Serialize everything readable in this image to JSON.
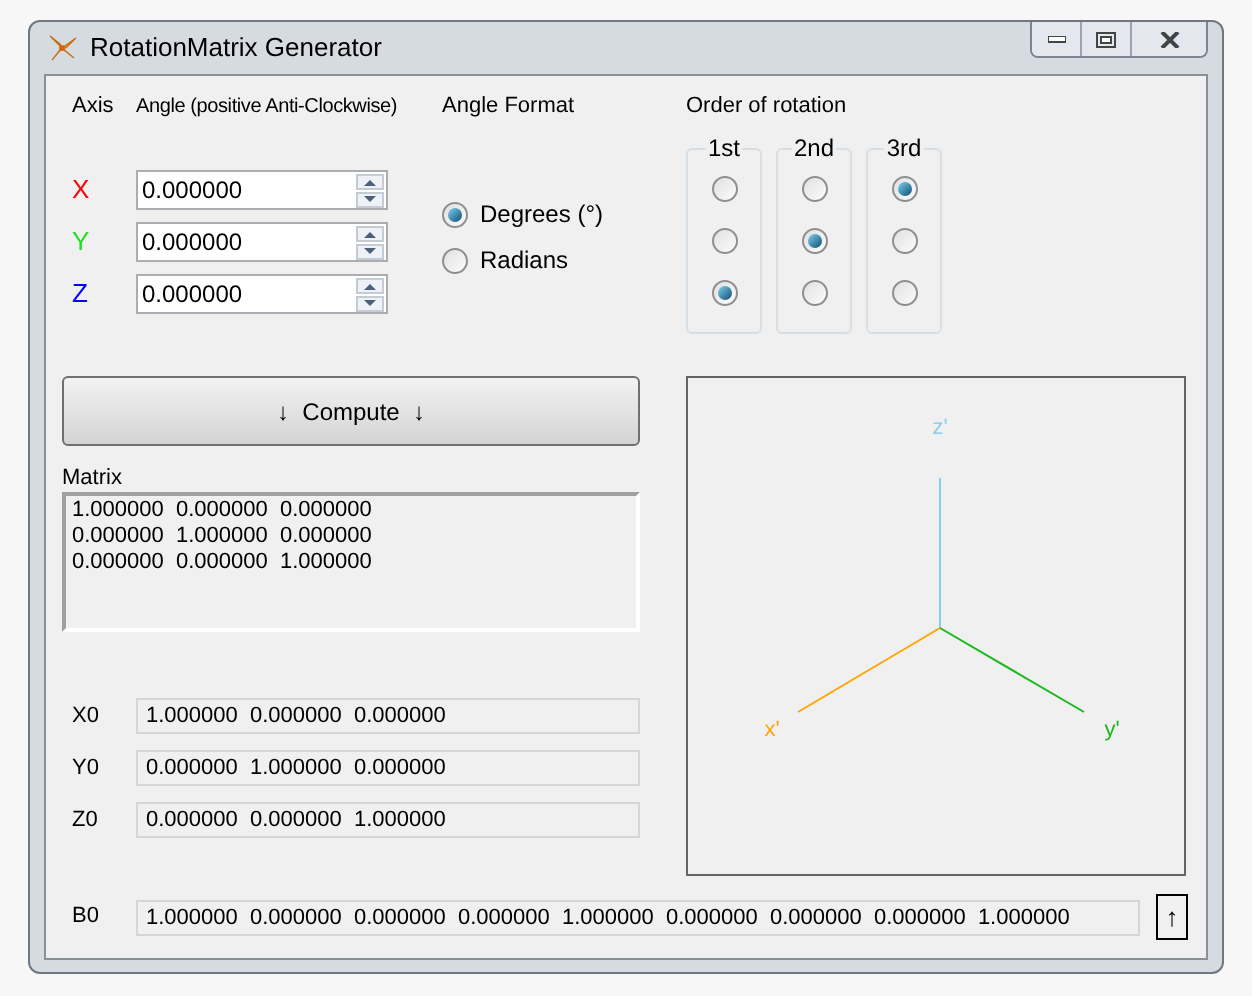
{
  "window": {
    "title": "RotationMatrix Generator"
  },
  "headers": {
    "axis": "Axis",
    "angle": "Angle (positive Anti-Clockwise)",
    "format": "Angle Format",
    "order": "Order of rotation"
  },
  "axes": [
    {
      "label": "X",
      "color": "#ff0000",
      "value": "0.000000"
    },
    {
      "label": "Y",
      "color": "#22dd22",
      "value": "0.000000"
    },
    {
      "label": "Z",
      "color": "#0000ff",
      "value": "0.000000"
    }
  ],
  "angle_format": [
    {
      "label": "Degrees (°)",
      "selected": true
    },
    {
      "label": "Radians",
      "selected": false
    }
  ],
  "order_groups": [
    {
      "label": "1st",
      "options": [
        {
          "selected": false
        },
        {
          "selected": false
        },
        {
          "selected": true
        }
      ]
    },
    {
      "label": "2nd",
      "options": [
        {
          "selected": false
        },
        {
          "selected": true
        },
        {
          "selected": false
        }
      ]
    },
    {
      "label": "3rd",
      "options": [
        {
          "selected": true
        },
        {
          "selected": false
        },
        {
          "selected": false
        }
      ]
    }
  ],
  "compute_button": {
    "label": "↓  Compute  ↓"
  },
  "matrix": {
    "label": "Matrix",
    "lines": [
      "1.000000  0.000000  0.000000",
      "0.000000  1.000000  0.000000",
      "0.000000  0.000000  1.000000"
    ]
  },
  "axes_view": {
    "labels": [
      {
        "text": "z'",
        "color": "#87ceeb"
      },
      {
        "text": "x'",
        "color": "#ffa500"
      },
      {
        "text": "y'",
        "color": "#1bb81b"
      }
    ]
  },
  "vectors": [
    {
      "label": "X0",
      "value": "1.000000  0.000000  0.000000"
    },
    {
      "label": "Y0",
      "value": "0.000000  1.000000  0.000000"
    },
    {
      "label": "Z0",
      "value": "0.000000  0.000000  1.000000"
    }
  ],
  "b0": {
    "label": "B0",
    "value": "1.000000  0.000000  0.000000  0.000000  1.000000  0.000000  0.000000  0.000000  1.000000"
  },
  "copy_button": {
    "label": "↑"
  }
}
